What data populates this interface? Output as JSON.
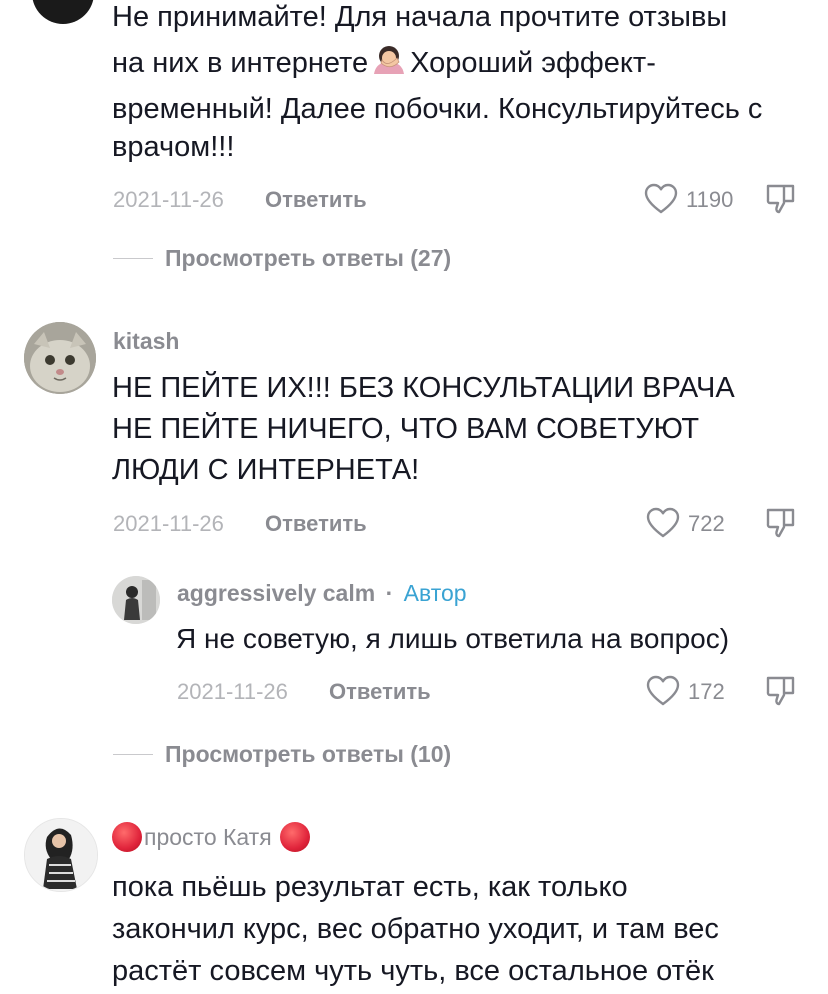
{
  "comments": [
    {
      "text_lines": [
        "Не принимайте! Для начала прочтите отзывы",
        "на них в интернете",
        "временный! Далее побочки. Консультируйтесь с",
        "врачом!!!"
      ],
      "text_line2_suffix": "Хороший эффект-",
      "date": "2021-11-26",
      "reply_label": "Ответить",
      "likes": "1190",
      "view_replies": "Просмотреть ответы (27)"
    },
    {
      "username": "kitash",
      "text_lines": [
        "НЕ ПЕЙТЕ ИХ!!! БЕЗ КОНСУЛЬТАЦИИ ВРАЧА",
        "НЕ ПЕЙТЕ НИЧЕГО, ЧТО ВАМ СОВЕТУЮТ",
        "ЛЮДИ С ИНТЕРНЕТА!"
      ],
      "date": "2021-11-26",
      "reply_label": "Ответить",
      "likes": "722",
      "reply": {
        "username": "aggressively calm",
        "separator": "·",
        "author_label": "Автор",
        "text": "Я не советую, я лишь ответила на вопрос)",
        "date": "2021-11-26",
        "reply_label": "Ответить",
        "likes": "172"
      },
      "view_replies": "Просмотреть ответы (10)"
    },
    {
      "username": "просто Катя",
      "text_lines": [
        "пока пьёшь результат есть, как только",
        "закончил курс, вес обратно уходит, и там вес",
        "растёт совсем чуть чуть, все остальное отёк"
      ]
    }
  ],
  "icons": {
    "like": "heart-outline-icon",
    "dislike": "thumbs-down-outline-icon",
    "emoji": "facepalm-emoji-icon",
    "status": "red-circle-icon"
  },
  "colors": {
    "text": "#161823",
    "muted": "#8a8b91",
    "date": "#b3b4b8",
    "author": "#3aa3d3",
    "red": "#e0243b"
  }
}
